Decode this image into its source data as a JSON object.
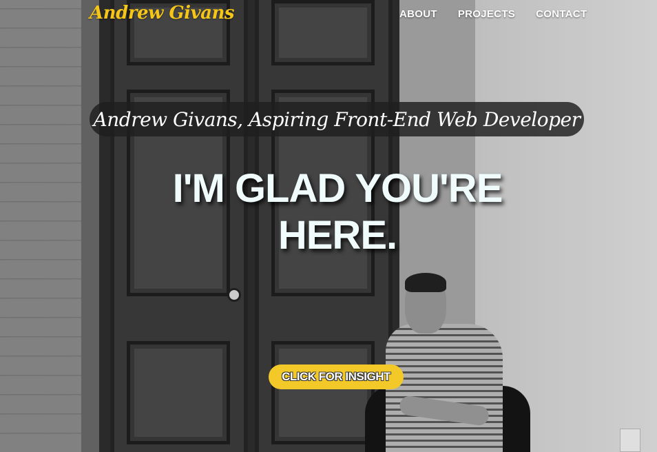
{
  "navbar": {
    "brand": "Andrew Givans",
    "links": [
      "ABOUT",
      "PROJECTS",
      "CONTACT"
    ]
  },
  "hero": {
    "tagline": "Andrew Givans, Aspiring Front-End Web Developer",
    "headline": "I'M GLAD YOU'RE HERE.",
    "cta_label": "CLICK FOR INSIGHT"
  },
  "colors": {
    "brand": "#f5c518",
    "cta_background": "#f3c92a",
    "tagline_background": "#1e1e1e",
    "headline_text": "#f0fbfb"
  }
}
